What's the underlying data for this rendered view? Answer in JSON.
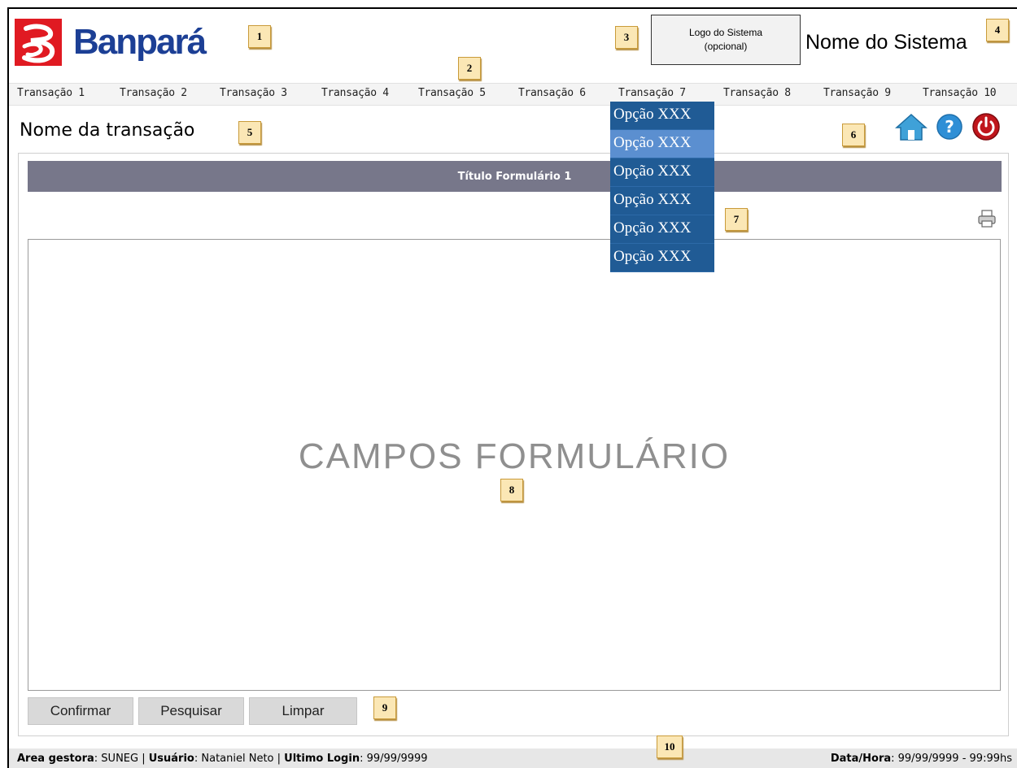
{
  "header": {
    "bank_name": "Banpará",
    "system_logo_line1": "Logo do Sistema",
    "system_logo_line2": "(opcional)",
    "system_name": "Nome do Sistema"
  },
  "menu": {
    "items": [
      "Transação 1",
      "Transação 2",
      "Transação 3",
      "Transação 4",
      "Transação 5",
      "Transação 6",
      "Transação 7",
      "Transação 8",
      "Transação 9",
      "Transação 10"
    ]
  },
  "dropdown": {
    "options": [
      "Opção XXX",
      "Opção XXX",
      "Opção XXX",
      "Opção XXX",
      "Opção XXX",
      "Opção XXX"
    ],
    "highlighted_index": 1
  },
  "page": {
    "transaction_name": "Nome da transação",
    "form_title": "Título Formulário 1",
    "form_placeholder": "CAMPOS FORMULÁRIO"
  },
  "buttons": {
    "confirm": "Confirmar",
    "search": "Pesquisar",
    "clear": "Limpar"
  },
  "icons": [
    "home-icon",
    "help-icon",
    "power-icon",
    "print-icon"
  ],
  "footer": {
    "area_label": "Area gestora",
    "area_value": "SUNEG",
    "user_label": "Usuário",
    "user_value": "Nataniel Neto",
    "login_label": "Ultimo Login",
    "login_value": "99/99/9999",
    "datetime_label": "Data/Hora",
    "datetime_value": "99/99/9999 - 99:99hs"
  },
  "callouts": [
    "1",
    "2",
    "3",
    "4",
    "5",
    "6",
    "7",
    "8",
    "9",
    "10"
  ],
  "colors": {
    "brand_red": "#e01a22",
    "brand_blue": "#1c3f95",
    "dropdown_bg": "#205b95",
    "dropdown_highlight": "#5b8fd0",
    "title_bar": "#77778a"
  }
}
